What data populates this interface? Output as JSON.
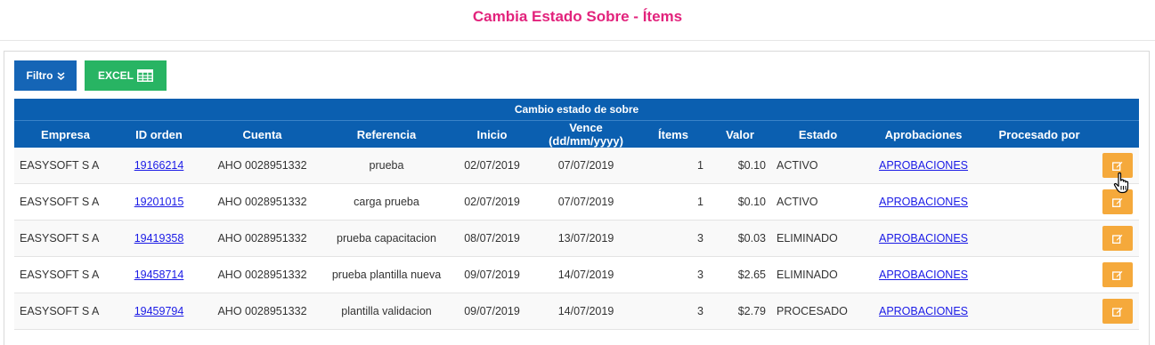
{
  "page_title": "Cambia Estado Sobre - Ítems",
  "toolbar": {
    "filter_label": "Filtro",
    "excel_label": "EXCEL"
  },
  "table": {
    "caption": "Cambio estado de sobre",
    "headers": [
      "Empresa",
      "ID orden",
      "Cuenta",
      "Referencia",
      "Inicio",
      "Vence (dd/mm/yyyy)",
      "Ítems",
      "Valor",
      "Estado",
      "Aprobaciones",
      "Procesado por"
    ],
    "rows": [
      {
        "empresa": "EASYSOFT S A",
        "id_orden": "19166214",
        "cuenta": "AHO 0028951332",
        "referencia": "prueba",
        "inicio": "02/07/2019",
        "vence": "07/07/2019",
        "items": "1",
        "valor": "$0.10",
        "estado": "ACTIVO",
        "aprobaciones": "APROBACIONES",
        "procesado_por": ""
      },
      {
        "empresa": "EASYSOFT S A",
        "id_orden": "19201015",
        "cuenta": "AHO 0028951332",
        "referencia": "carga prueba",
        "inicio": "02/07/2019",
        "vence": "07/07/2019",
        "items": "1",
        "valor": "$0.10",
        "estado": "ACTIVO",
        "aprobaciones": "APROBACIONES",
        "procesado_por": ""
      },
      {
        "empresa": "EASYSOFT S A",
        "id_orden": "19419358",
        "cuenta": "AHO 0028951332",
        "referencia": "prueba capacitacion",
        "inicio": "08/07/2019",
        "vence": "13/07/2019",
        "items": "3",
        "valor": "$0.03",
        "estado": "ELIMINADO",
        "aprobaciones": "APROBACIONES",
        "procesado_por": ""
      },
      {
        "empresa": "EASYSOFT S A",
        "id_orden": "19458714",
        "cuenta": "AHO 0028951332",
        "referencia": "prueba plantilla nueva",
        "inicio": "09/07/2019",
        "vence": "14/07/2019",
        "items": "3",
        "valor": "$2.65",
        "estado": "ELIMINADO",
        "aprobaciones": "APROBACIONES",
        "procesado_por": ""
      },
      {
        "empresa": "EASYSOFT S A",
        "id_orden": "19459794",
        "cuenta": "AHO 0028951332",
        "referencia": "plantilla validacion",
        "inicio": "09/07/2019",
        "vence": "14/07/2019",
        "items": "3",
        "valor": "$2.79",
        "estado": "PROCESADO",
        "aprobaciones": "APROBACIONES",
        "procesado_por": ""
      }
    ]
  },
  "icons": {
    "filter": "double-chevron-down-icon",
    "excel": "spreadsheet-grid-icon",
    "edit": "edit-icon",
    "cursor": "hand-pointer-icon"
  },
  "colors": {
    "title": "#e2237c",
    "header_bg": "#0b5fb0",
    "filter_btn": "#1565b6",
    "excel_btn": "#28b463",
    "edit_btn": "#f5a93b",
    "link": "#1a1ae6"
  }
}
